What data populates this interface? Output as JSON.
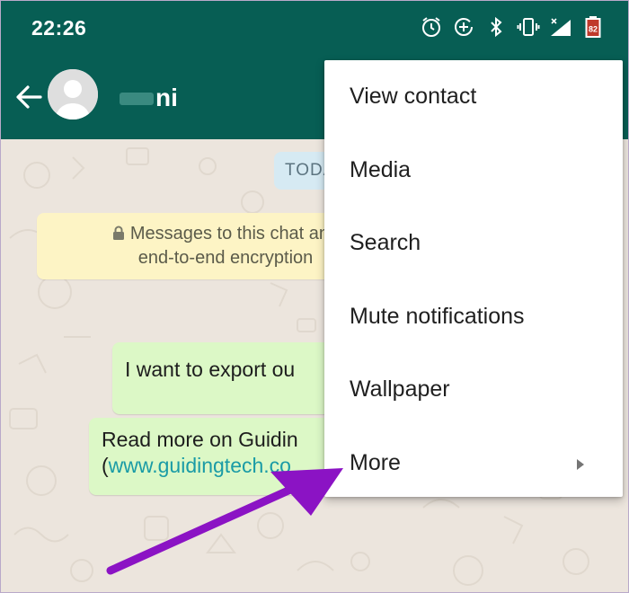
{
  "status_bar": {
    "time": "22:26",
    "battery": "82",
    "icons": [
      "alarm-icon",
      "data-saver-icon",
      "bluetooth-icon",
      "vibrate-icon",
      "signal-icon",
      "battery-icon"
    ]
  },
  "app_bar": {
    "contact_name": "ni",
    "icons": [
      "back-arrow-icon",
      "avatar"
    ]
  },
  "chat": {
    "date_chip": "TODA",
    "encryption_notice": {
      "line1": "Messages to this chat and",
      "line2": "end-to-end encryption"
    },
    "messages": [
      {
        "text": "I want to export ou"
      },
      {
        "line1": "Read more on Guidin",
        "line2_prefix": "(",
        "link": "www.guidingtech.co"
      }
    ]
  },
  "menu": {
    "items": [
      {
        "label": "View contact"
      },
      {
        "label": "Media"
      },
      {
        "label": "Search"
      },
      {
        "label": "Mute notifications"
      },
      {
        "label": "Wallpaper"
      },
      {
        "label": "More",
        "has_submenu": true
      }
    ]
  },
  "colors": {
    "header": "#075e54",
    "bubble": "#dcf8c6",
    "notice": "#fdf4c5",
    "annotation_arrow": "#8b13c4"
  }
}
